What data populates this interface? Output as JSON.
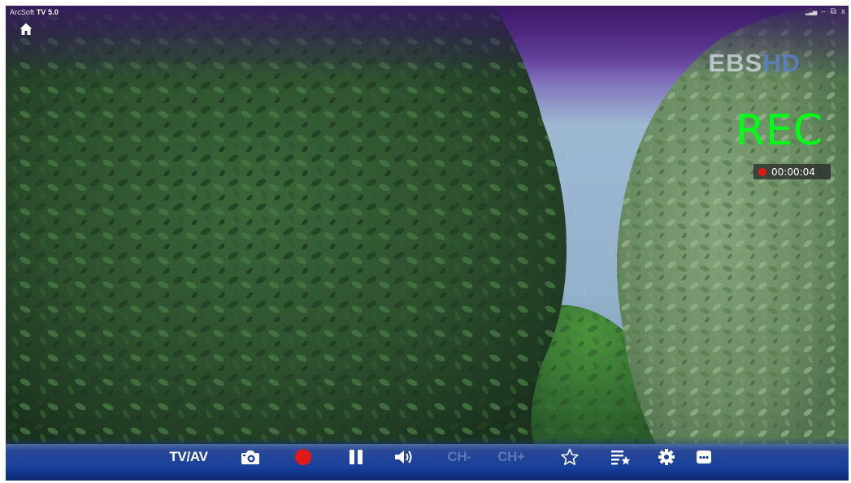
{
  "app": {
    "title_prefix": "ArcSoft",
    "title_name": "TV 5.0"
  },
  "window_controls": {
    "signal_icon": "signal-bars-icon",
    "minimize": "–",
    "restore": "⧉",
    "close": "x"
  },
  "overlay": {
    "channel_logo_main": "EBS",
    "channel_logo_suffix": "HD",
    "rec_label": "REC",
    "rec_time": "00:00:04"
  },
  "toolbar": {
    "tv_av_label": "TV/AV",
    "ch_minus_label": "CH-",
    "ch_plus_label": "CH+",
    "icons": [
      "home-icon",
      "camera-icon",
      "record-icon",
      "pause-icon",
      "volume-icon",
      "star-icon",
      "playlist-star-icon",
      "gear-icon",
      "more-icon"
    ]
  },
  "colors": {
    "rec_green": "#00ff16",
    "record_red": "#e01818",
    "toolbar_blue": "#173f9c",
    "disabled_text": "#5f78b5"
  }
}
